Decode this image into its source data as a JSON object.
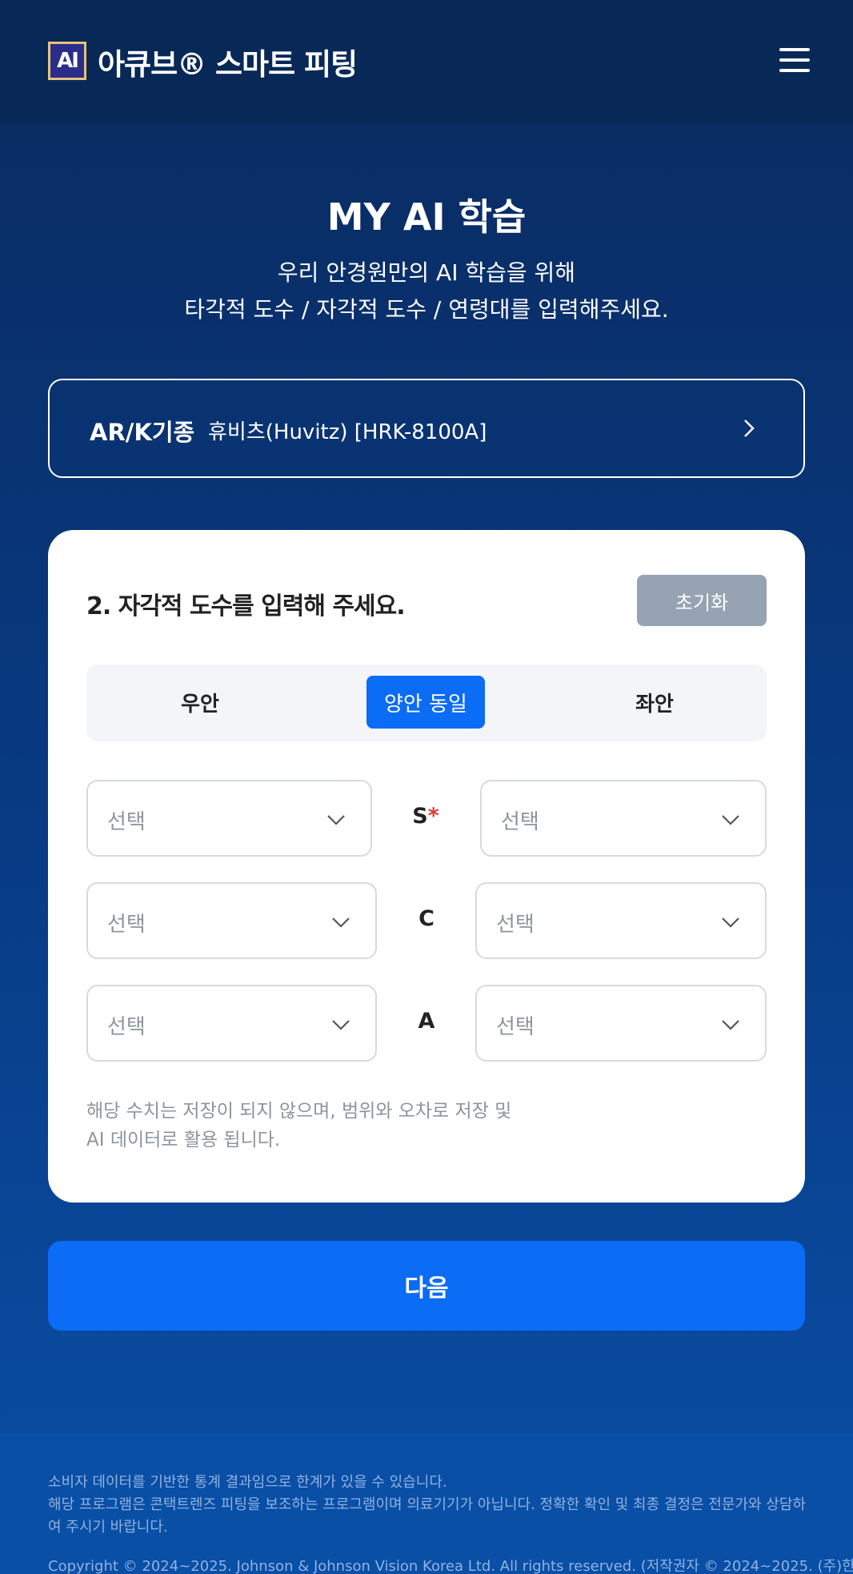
{
  "header": {
    "logo_text": "AI",
    "brand": "아큐브® 스마트 피팅"
  },
  "page": {
    "title": "MY AI 학습",
    "subtitle_line1": "우리 안경원만의 AI 학습을 위해",
    "subtitle_line2": "타각적 도수 / 자각적 도수 / 연령대를 입력해주세요."
  },
  "model": {
    "label": "AR/K기종",
    "value": "휴비츠(Huvitz) [HRK-8100A]"
  },
  "card": {
    "title": "2. 자각적 도수를 입력해 주세요.",
    "reset_label": "초기화",
    "tabs": [
      {
        "label": "우안",
        "active": false
      },
      {
        "label": "양안 동일",
        "active": true
      },
      {
        "label": "좌안",
        "active": false
      }
    ],
    "rows": [
      {
        "label": "S",
        "required_mark": "*",
        "left_placeholder": "선택",
        "right_placeholder": "선택"
      },
      {
        "label": "C",
        "left_placeholder": "선택",
        "right_placeholder": "선택"
      },
      {
        "label": "A",
        "left_placeholder": "선택",
        "right_placeholder": "선택"
      }
    ],
    "note_line1": "해당 수치는 저장이 되지 않으며, 범위와 오차로 저장 및",
    "note_line2": "AI 데이터로 활용 됩니다."
  },
  "next_label": "다음",
  "footer": {
    "line1": "소비자 데이터를 기반한 통계 결과임으로 한계가 있을 수 있습니다.",
    "line2": "해당 프로그램은 콘택트렌즈 피팅을 보조하는 프로그램이며 의료기기가 아닙니다. 정확한 확인 및 최종 결정은 전문가와 상담하여 주시기 바랍니다.",
    "copyright": "Copyright © 2024~2025. Johnson & Johnson Vision Korea Ltd. All rights reserved. (저작권자 © 2024~2025. (주)한"
  },
  "colors": {
    "accent": "#0b6cf5",
    "reset_button": "#95a3b2",
    "required": "#e23636"
  }
}
